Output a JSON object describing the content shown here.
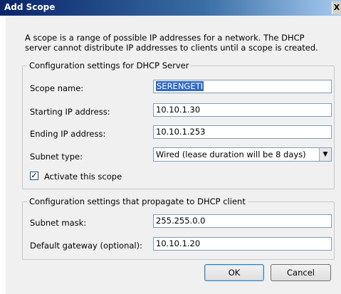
{
  "window": {
    "title": "Add Scope",
    "close_glyph": "X"
  },
  "description": "A scope is a range of possible IP addresses for a network. The DHCP server cannot distribute IP addresses to clients until a scope is created.",
  "server_group": {
    "legend": "Configuration settings for DHCP Server",
    "scope_name_label": "Scope name:",
    "scope_name_value": "SERENGETI",
    "start_ip_label": "Starting IP address:",
    "start_ip_value": "10.10.1.30",
    "end_ip_label": "Ending IP address:",
    "end_ip_value": "10.10.1.253",
    "subnet_type_label": "Subnet type:",
    "subnet_type_value": "Wired (lease duration will be 8 days)",
    "activate_label": "Activate this scope",
    "activate_checked": true,
    "check_glyph": "✓"
  },
  "client_group": {
    "legend": "Configuration settings that propagate to DHCP client",
    "subnet_mask_label": "Subnet mask:",
    "subnet_mask_value": "255.255.0.0",
    "gateway_label": "Default gateway (optional):",
    "gateway_value": "10.10.1.20"
  },
  "buttons": {
    "ok": "OK",
    "cancel": "Cancel"
  },
  "icons": {
    "dropdown": "▼"
  }
}
